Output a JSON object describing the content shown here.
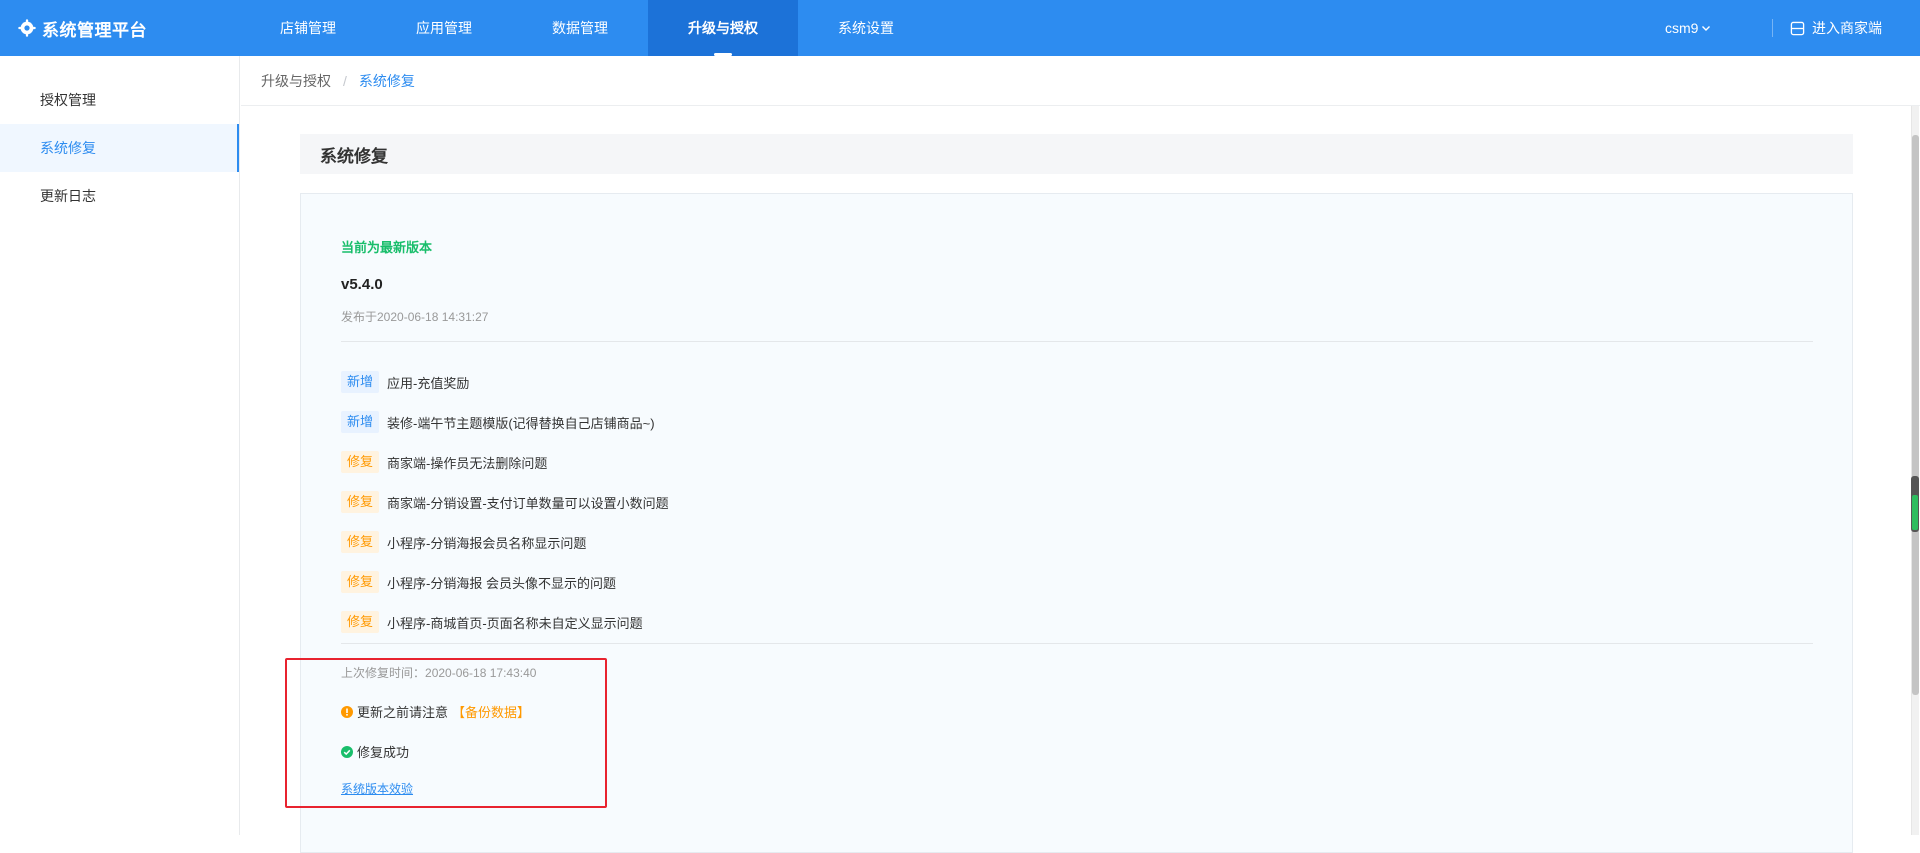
{
  "brand": {
    "title": "系统管理平台",
    "icon": "gear-icon"
  },
  "nav": {
    "items": [
      {
        "label": "店铺管理",
        "active": false
      },
      {
        "label": "应用管理",
        "active": false
      },
      {
        "label": "数据管理",
        "active": false
      },
      {
        "label": "升级与授权",
        "active": true
      },
      {
        "label": "系统设置",
        "active": false
      }
    ],
    "user": "csm9",
    "merchant_link": "进入商家端"
  },
  "sidebar": {
    "items": [
      {
        "label": "授权管理",
        "active": false
      },
      {
        "label": "系统修复",
        "active": true
      },
      {
        "label": "更新日志",
        "active": false
      }
    ]
  },
  "breadcrumb": {
    "parent": "升级与授权",
    "separator": "/",
    "current": "系统修复"
  },
  "section": {
    "title": "系统修复"
  },
  "release": {
    "status": "当前为最新版本",
    "version": "v5.4.0",
    "released": "发布于2020-06-18 14:31:27",
    "changes": [
      {
        "tag": "新增",
        "type": "new",
        "text": "应用-充值奖励"
      },
      {
        "tag": "新增",
        "type": "new",
        "text": "装修-端午节主题模版(记得替换自己店铺商品~)"
      },
      {
        "tag": "修复",
        "type": "fix",
        "text": "商家端-操作员无法删除问题"
      },
      {
        "tag": "修复",
        "type": "fix",
        "text": "商家端-分销设置-支付订单数量可以设置小数问题"
      },
      {
        "tag": "修复",
        "type": "fix",
        "text": "小程序-分销海报会员名称显示问题"
      },
      {
        "tag": "修复",
        "type": "fix",
        "text": "小程序-分销海报 会员头像不显示的问题"
      },
      {
        "tag": "修复",
        "type": "fix",
        "text": "小程序-商城首页-页面名称未自定义显示问题"
      }
    ]
  },
  "repair": {
    "last_fix_label": "上次修复时间：",
    "last_fix_time": "2020-06-18 17:43:40",
    "notice_text": "更新之前请注意",
    "notice_highlight": "【备份数据】",
    "success_text": "修复成功",
    "verify_link": "系统版本效验"
  },
  "colors": {
    "primary": "#2d8cf0",
    "success": "#19be6b",
    "warning": "#ff9900",
    "annotation": "#e8232f"
  }
}
